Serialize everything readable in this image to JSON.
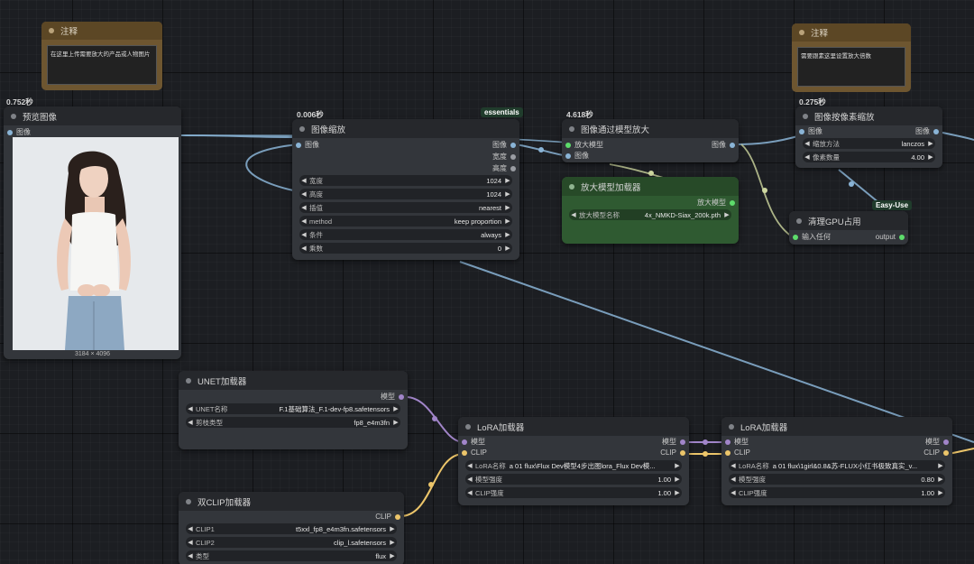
{
  "nodes": {
    "note1": {
      "title": "注释",
      "text": "在这里上传需要放大的产品或人物图片"
    },
    "note2": {
      "title": "注释",
      "text": "需要跟素这里设置放大倍数"
    },
    "preview": {
      "time": "0.752秒",
      "title": "预览图像",
      "input": "图像",
      "dims": "3184 × 4096"
    },
    "scale": {
      "time": "0.006秒",
      "badge": "essentials",
      "title": "图像缩放",
      "input": "图像",
      "outputs": [
        "图像",
        "宽度",
        "高度"
      ],
      "widgets": [
        {
          "label": "宽度",
          "value": "1024"
        },
        {
          "label": "高度",
          "value": "1024"
        },
        {
          "label": "插值",
          "value": "nearest"
        },
        {
          "label": "method",
          "value": "keep proportion"
        },
        {
          "label": "条件",
          "value": "always"
        },
        {
          "label": "乘数",
          "value": "0"
        }
      ]
    },
    "upscale": {
      "time": "4.618秒",
      "title": "图像通过模型放大",
      "inputs": [
        "放大模型",
        "图像"
      ],
      "output": "图像"
    },
    "loader": {
      "title": "放大模型加载器",
      "output": "放大模型",
      "widget_label": "放大模型名称",
      "widget_value": "4x_NMKD-Siax_200k.pth"
    },
    "pixscale": {
      "time": "0.275秒",
      "title": "图像按像素缩放",
      "input": "图像",
      "output": "图像",
      "widgets": [
        {
          "label": "缩放方法",
          "value": "lanczos"
        },
        {
          "label": "像素数量",
          "value": "4.00"
        }
      ]
    },
    "gpu": {
      "badge": "Easy-Use",
      "title": "清理GPU占用",
      "input": "输入任何",
      "output": "output"
    },
    "unet": {
      "title": "UNET加载器",
      "output": "模型",
      "widgets": [
        {
          "label": "UNET名称",
          "value": "F.1基础算法_F.1-dev-fp8.safetensors"
        },
        {
          "label": "剪枝类型",
          "value": "fp8_e4m3fn"
        }
      ]
    },
    "lora1": {
      "title": "LoRA加载器",
      "inputs": [
        "模型",
        "CLIP"
      ],
      "outputs": [
        "模型",
        "CLIP"
      ],
      "widgets": [
        {
          "label": "LoRA名称",
          "value": "a 01 flux\\Flux Dev模型4步出图lora_Flux Dev模..."
        },
        {
          "label": "模型强度",
          "value": "1.00"
        },
        {
          "label": "CLIP强度",
          "value": "1.00"
        }
      ]
    },
    "lora2": {
      "title": "LoRA加载器",
      "inputs": [
        "模型",
        "CLIP"
      ],
      "outputs": [
        "模型",
        "CLIP"
      ],
      "widgets": [
        {
          "label": "LoRA名称",
          "value": "a 01 flux\\1girl&0.8&苏-FLUX小红书极致真实_v..."
        },
        {
          "label": "模型强度",
          "value": "0.80"
        },
        {
          "label": "CLIP强度",
          "value": "1.00"
        }
      ]
    },
    "dualclip": {
      "title": "双CLIP加载器",
      "output": "CLIP",
      "widgets": [
        {
          "label": "CLIP1",
          "value": "t5xxl_fp8_e4m3fn.safetensors"
        },
        {
          "label": "CLIP2",
          "value": "clip_l.safetensors"
        },
        {
          "label": "类型",
          "value": "flux"
        }
      ]
    }
  },
  "colors": {
    "image_link": "#8ab4d6",
    "model_link": "#a185c9",
    "clip_link": "#ecc56a",
    "any_link": "#cfd8a0",
    "loader_bg": "#2f5a31",
    "note_title": "#5c4725"
  }
}
